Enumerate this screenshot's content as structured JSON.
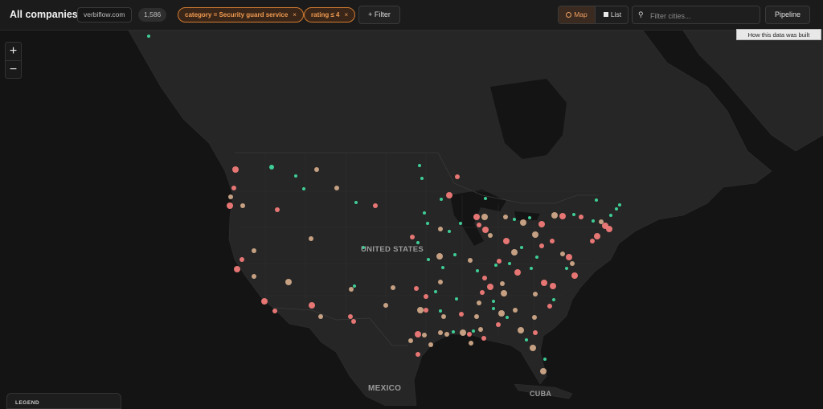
{
  "header": {
    "title": "All companies",
    "domain": "verbiflow.com",
    "count": "1,586",
    "filters": [
      {
        "label": "category = Security guard service",
        "remove": "×"
      },
      {
        "label": "rating ≤ 4",
        "remove": "×"
      }
    ],
    "add_filter": "+ Filter",
    "view_map": "Map",
    "view_list": "List",
    "active_view": "Map",
    "search_placeholder": "Filter cities...",
    "pipeline": "Pipeline",
    "tooltip": "How this data was built"
  },
  "map": {
    "zoom_in": "+",
    "zoom_out": "−",
    "labels": {
      "us": "UNITED STATES",
      "mexico": "MEXICO",
      "cuba": "CUBA"
    },
    "legend_title": "LEGEND"
  },
  "colors": {
    "marker_a": "#f07a78",
    "marker_b": "#3fd69b",
    "marker_mixed": "#cda787",
    "accent": "#f09a50"
  }
}
